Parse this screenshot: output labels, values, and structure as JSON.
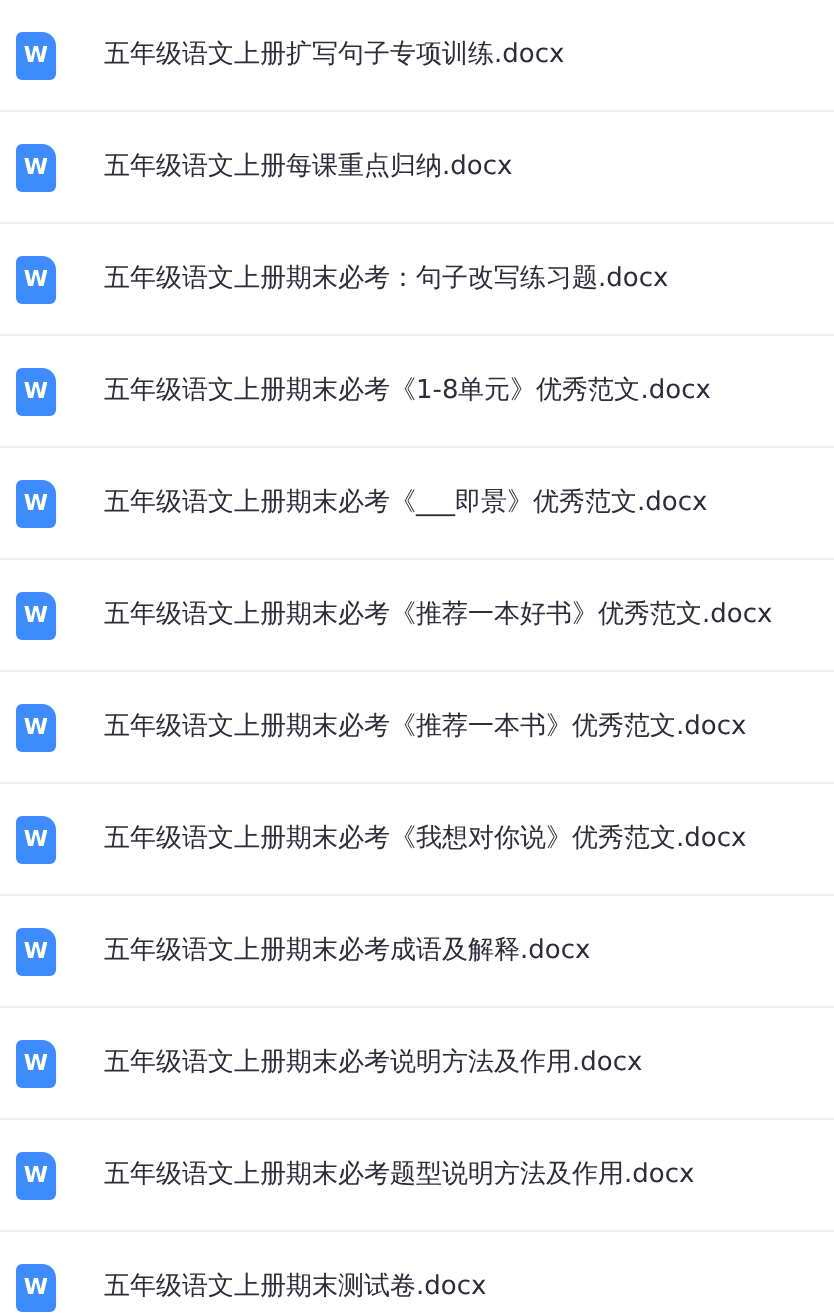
{
  "files": [
    {
      "icon_letter": "W",
      "name": "五年级语文上册扩写句子专项训练.docx"
    },
    {
      "icon_letter": "W",
      "name": "五年级语文上册每课重点归纳.docx"
    },
    {
      "icon_letter": "W",
      "name": "五年级语文上册期末必考：句子改写练习题.docx"
    },
    {
      "icon_letter": "W",
      "name": "五年级语文上册期末必考《1-8单元》优秀范文.docx"
    },
    {
      "icon_letter": "W",
      "name": "五年级语文上册期末必考《___即景》优秀范文.docx"
    },
    {
      "icon_letter": "W",
      "name": "五年级语文上册期末必考《推荐一本好书》优秀范文.docx"
    },
    {
      "icon_letter": "W",
      "name": "五年级语文上册期末必考《推荐一本书》优秀范文.docx"
    },
    {
      "icon_letter": "W",
      "name": "五年级语文上册期末必考《我想对你说》优秀范文.docx"
    },
    {
      "icon_letter": "W",
      "name": "五年级语文上册期末必考成语及解释.docx"
    },
    {
      "icon_letter": "W",
      "name": "五年级语文上册期末必考说明方法及作用.docx"
    },
    {
      "icon_letter": "W",
      "name": "五年级语文上册期末必考题型说明方法及作用.docx"
    },
    {
      "icon_letter": "W",
      "name": "五年级语文上册期末测试卷.docx"
    }
  ]
}
